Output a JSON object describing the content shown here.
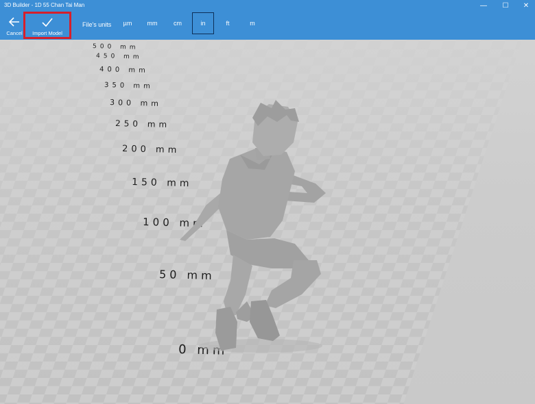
{
  "window": {
    "title": "3D Builder - 1D 55 Chan Tai Man",
    "controls": {
      "minimize": "—",
      "maximize": "☐",
      "close": "✕"
    }
  },
  "toolbar": {
    "cancel": {
      "label": "Cancel",
      "icon": "back-arrow-icon"
    },
    "import": {
      "label": "Import Model",
      "icon": "checkmark-icon"
    },
    "units_label": "File's units",
    "units": [
      "µm",
      "mm",
      "cm",
      "in",
      "ft",
      "m"
    ],
    "selected_unit": "in",
    "highlight_color": "#d61f2b"
  },
  "scene": {
    "ruler_labels": [
      "500 mm",
      "450 mm",
      "400 mm",
      "350 mm",
      "300 mm",
      "250 mm",
      "200 mm",
      "150 mm",
      "100 mm",
      "50 mm",
      "0 mm"
    ],
    "floor_color": "#cbcbcb",
    "model_color": "#a6a6a6"
  }
}
